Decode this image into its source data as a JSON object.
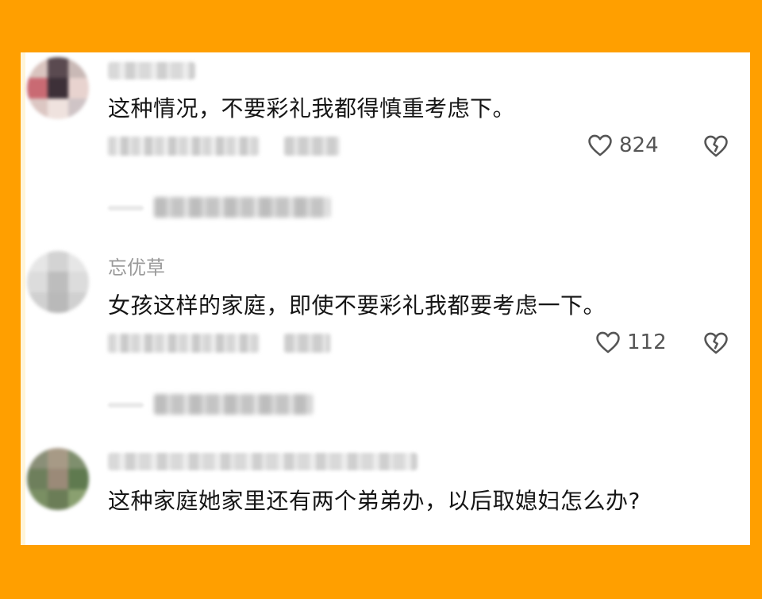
{
  "comments": [
    {
      "username": "",
      "text": "这种情况，不要彩礼我都得慎重考虑下。",
      "likes": "824"
    },
    {
      "username": "忘优草",
      "text": "女孩这样的家庭，即使不要彩礼我都要考虑一下。",
      "likes": "112"
    },
    {
      "username": "",
      "text": "这种家庭她家里还有两个弟弟办，以后取媳妇怎么办?",
      "likes": ""
    }
  ],
  "icons": {
    "like": "heart-outline-icon",
    "dislike": "broken-heart-icon"
  },
  "colors": {
    "background": "#FF9F00",
    "card": "#FFFFFF",
    "text": "#151515",
    "muted": "#9A9A9A"
  }
}
